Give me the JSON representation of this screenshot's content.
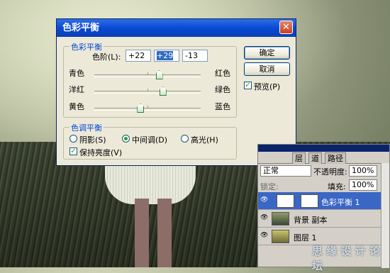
{
  "dialog": {
    "title": "色彩平衡",
    "close_glyph": "✕",
    "color_balance_group": "色彩平衡",
    "levels_label": "色阶(L):",
    "levels": [
      "+22",
      "+29",
      "-13"
    ],
    "sliders": [
      {
        "left": "青色",
        "right": "红色",
        "value": 22
      },
      {
        "left": "洋红",
        "right": "绿色",
        "value": 29
      },
      {
        "left": "黄色",
        "right": "蓝色",
        "value": -13
      }
    ],
    "tone_group": "色调平衡",
    "tones": [
      "阴影(S)",
      "中间调(D)",
      "高光(H)"
    ],
    "selected_tone": "中间调(D)",
    "preserve_luminosity": "保持亮度(V)",
    "preserve_luminosity_checked": true,
    "ok": "确定",
    "cancel": "取消",
    "preview": "预览(P)",
    "preview_checked": true
  },
  "layers_panel": {
    "tabs": [
      "层",
      "道",
      "路径"
    ],
    "blend_mode": "正常",
    "opacity_label": "不透明度:",
    "opacity": "100%",
    "lock_label": "锁定:",
    "fill_label": "填充:",
    "fill": "100%",
    "layers": [
      {
        "name": "色彩平衡 1",
        "active": true
      },
      {
        "name": "背景 副本",
        "active": false
      },
      {
        "name": "图层 1",
        "active": false
      }
    ]
  },
  "watermark": "思 缘 设 计 论 坛"
}
